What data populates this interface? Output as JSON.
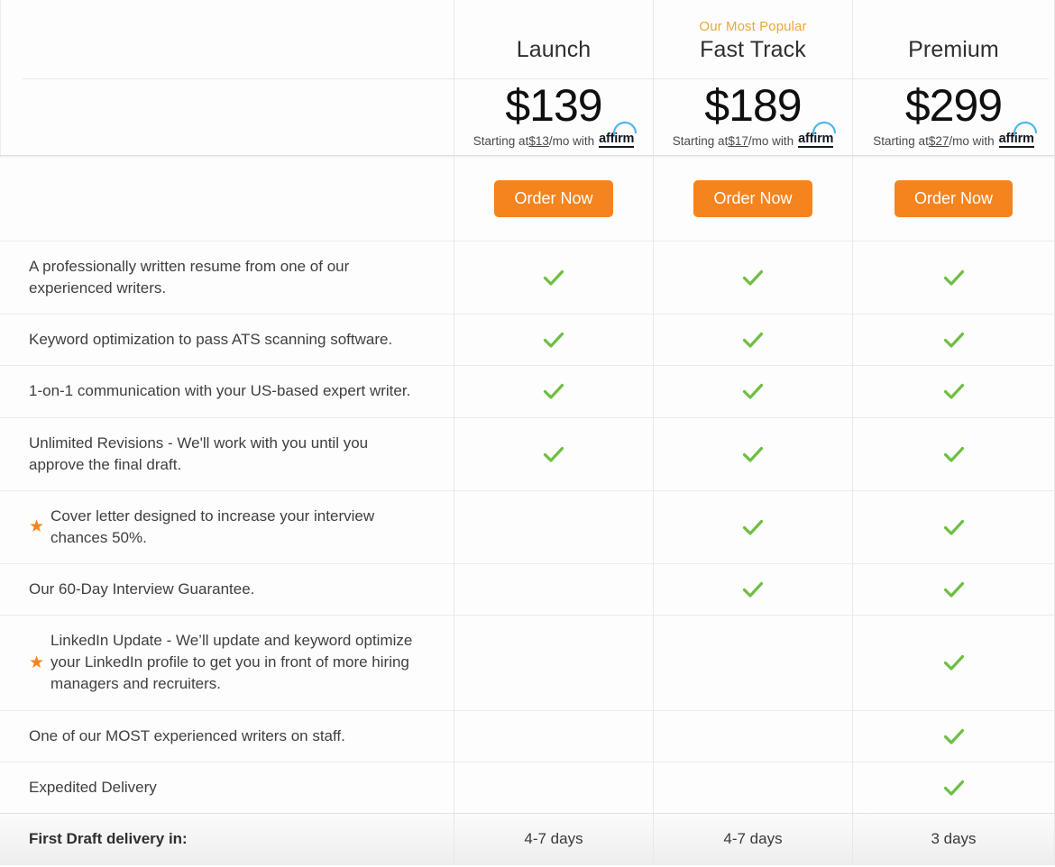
{
  "plans": [
    {
      "id": "launch",
      "name": "Launch",
      "popular_tag": "",
      "price": "$139",
      "financing_prefix": "Starting at ",
      "financing_amount": "$13",
      "financing_suffix": "/mo with ",
      "financing_brand": "affirm",
      "cta_label": "Order Now",
      "delivery": "4-7 days"
    },
    {
      "id": "fast-track",
      "name": "Fast Track",
      "popular_tag": "Our Most Popular",
      "price": "$189",
      "financing_prefix": "Starting at ",
      "financing_amount": "$17",
      "financing_suffix": "/mo with ",
      "financing_brand": "affirm",
      "cta_label": "Order Now",
      "delivery": "4-7 days"
    },
    {
      "id": "premium",
      "name": "Premium",
      "popular_tag": "",
      "price": "$299",
      "financing_prefix": "Starting at ",
      "financing_amount": "$27",
      "financing_suffix": "/mo with ",
      "financing_brand": "affirm",
      "cta_label": "Order Now",
      "delivery": "3 days"
    }
  ],
  "features": [
    {
      "starred": false,
      "text": "A professionally written resume from one of our experienced writers.",
      "included": [
        true,
        true,
        true
      ]
    },
    {
      "starred": false,
      "text": "Keyword optimization to pass ATS scanning software.",
      "included": [
        true,
        true,
        true
      ]
    },
    {
      "starred": false,
      "text": "1-on-1 communication with your US-based expert writer.",
      "included": [
        true,
        true,
        true
      ]
    },
    {
      "starred": false,
      "text": "Unlimited Revisions - We'll work with you until you approve the final draft.",
      "included": [
        true,
        true,
        true
      ]
    },
    {
      "starred": true,
      "text": "Cover letter designed to increase your interview chances 50%.",
      "included": [
        false,
        true,
        true
      ]
    },
    {
      "starred": false,
      "text": "Our 60-Day Interview Guarantee.",
      "included": [
        false,
        true,
        true
      ]
    },
    {
      "starred": true,
      "text": "LinkedIn Update - We’ll update and keyword optimize your LinkedIn profile to get you in front of more hiring managers and recruiters.",
      "included": [
        false,
        false,
        true
      ]
    },
    {
      "starred": false,
      "text": "One of our MOST experienced writers on staff.",
      "included": [
        false,
        false,
        true
      ]
    },
    {
      "starred": false,
      "text": "Expedited Delivery",
      "included": [
        false,
        false,
        true
      ]
    }
  ],
  "delivery_row": {
    "label": "First Draft delivery in:"
  },
  "icons": {
    "star": "★",
    "check": "check-icon"
  },
  "colors": {
    "cta_orange": "#F5841F",
    "check_green": "#6FBE44",
    "popular_amber": "#E9A93C",
    "star_orange": "#F5841F",
    "affirm_blue": "#4FB6E8"
  }
}
